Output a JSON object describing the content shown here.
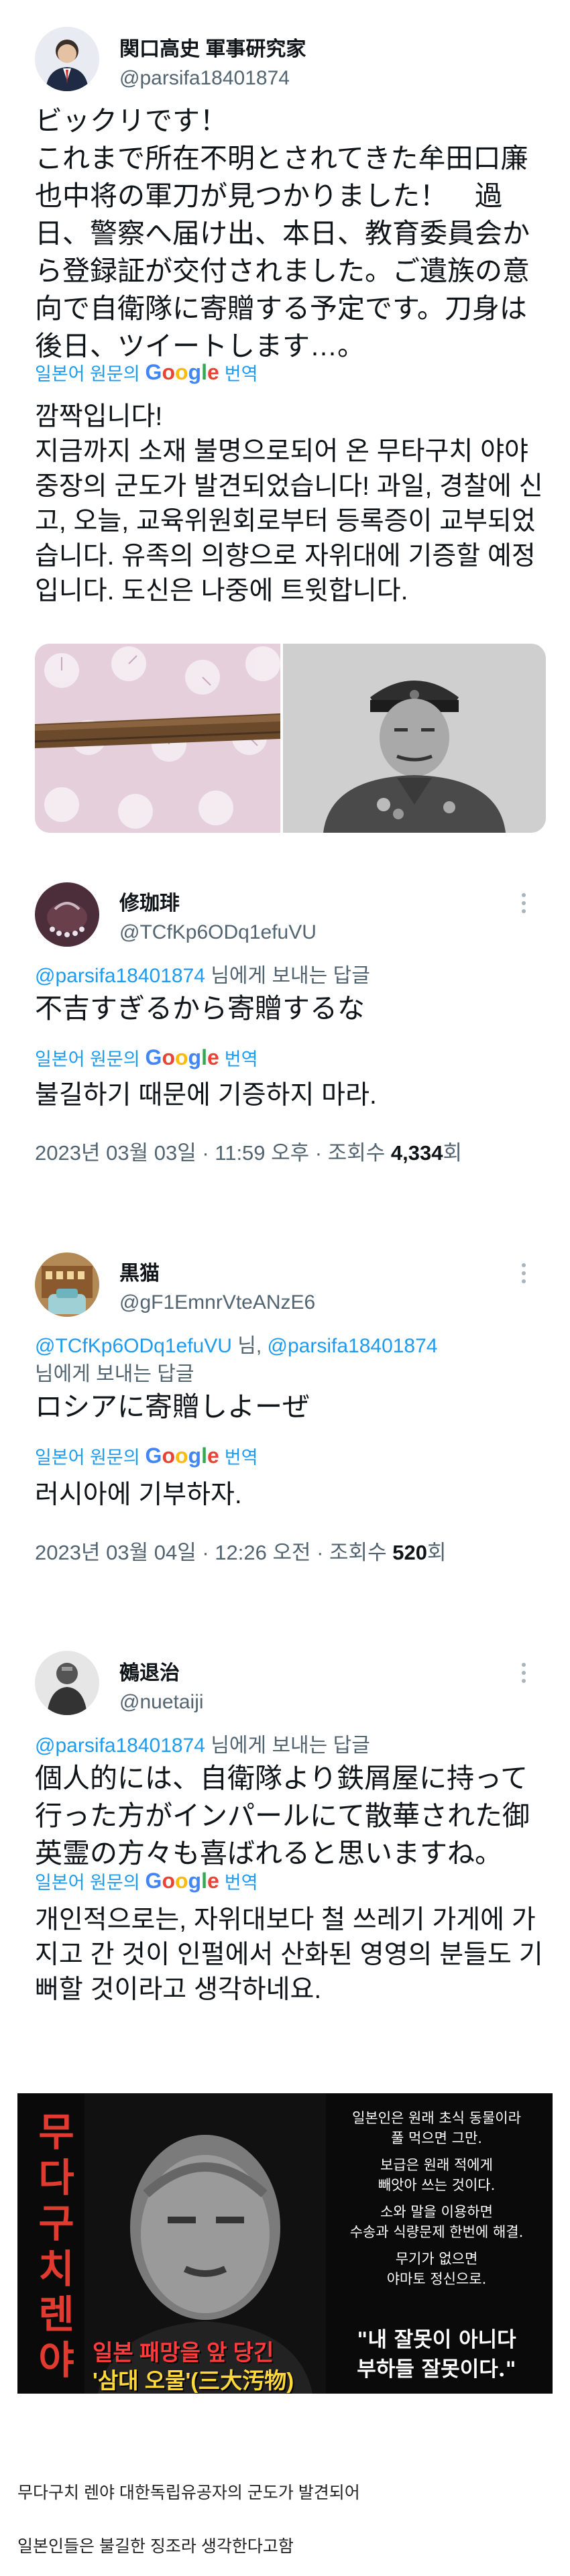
{
  "post_main": {
    "author_name": "関口高史 軍事研究家",
    "handle": "@parsifa18401874",
    "text_jp": "ビックリです！\nこれまで所在不明とされてきた牟田口廉也中将の軍刀が見つかりました！　過日、警察へ届け出、本日、教育委員会から登録証が交付されました。ご遺族の意向で自衛隊に寄贈する予定です。刀身は後日、ツイートします…。",
    "translate_label": "일본어 원문의",
    "translate_suffix": "번역",
    "text_kr": "깜짝입니다!\n지금까지 소재 불명으로되어 온 무타구치 야야 중장의 군도가 발견되었습니다! 과일, 경찰에 신고, 오늘, 교육위원회로부터 등록증이 교부되었습니다. 유족의 의향으로 자위대에 기증할 예정입니다. 도신은 나중에 트윗합니다."
  },
  "reply1": {
    "author_name": "修珈琲",
    "handle": "@TCfKp6ODq1efuVU",
    "reply_mention": "@parsifa18401874",
    "reply_suffix": " 님에게 보내는 답글",
    "text_jp": "不吉すぎるから寄贈するな",
    "translate_label": "일본어 원문의",
    "translate_suffix": "번역",
    "text_kr": "불길하기 때문에 기증하지 마라.",
    "meta_prefix": "2023년 03월 03일 · 11:59 오후 · 조회수 ",
    "views": "4,334",
    "meta_suffix": "회"
  },
  "reply2": {
    "author_name": "黒猫",
    "handle": "@gF1EmnrVteANzE6",
    "reply_mention_1": "@TCfKp6ODq1efuVU",
    "reply_mid": " 님, ",
    "reply_mention_2": "@parsifa18401874",
    "reply_line2": "님에게 보내는 답글",
    "text_jp": "ロシアに寄贈しよーぜ",
    "translate_label": "일본어 원문의",
    "translate_suffix": "번역",
    "text_kr": "러시아에 기부하자.",
    "meta_prefix": "2023년 03월 04일 · 12:26 오전 · 조회수 ",
    "views": "520",
    "meta_suffix": "회"
  },
  "reply3": {
    "author_name": "鵺退治",
    "handle": "@nuetaiji",
    "reply_mention": "@parsifa18401874",
    "reply_suffix": " 님에게 보내는 답글",
    "text_jp": "個人的には、自衛隊より鉄屑屋に持って行った方がインパールにて散華された御英霊の方々も喜ばれると思いますね。",
    "translate_label": "일본어 원문의",
    "translate_suffix": "번역",
    "text_kr": "개인적으로는, 자위대보다 철 쓰레기 가게에 가지고 간 것이 인펄에서 산화된 영영의 분들도 기뻐할 것이라고 생각하네요."
  },
  "meme": {
    "vertical_name": [
      "무",
      "다",
      "구",
      "치",
      "렌",
      "야"
    ],
    "left_line1": "일본 패망을 앞 당긴",
    "left_line2": "'삼대 오물'(三大汚物)",
    "right_lines": [
      "일본인은 원래 초식 동물이라",
      "풀 먹으면 그만.",
      "보급은 원래 적에게",
      "빼앗아 쓰는 것이다.",
      "소와 말을 이용하면",
      "수송과 식량문제 한번에 해결.",
      "무기가 없으면",
      "야마토 정신으로."
    ],
    "quote": "\"내 잘못이 아니다\n부하들 잘못이다.\""
  },
  "captions": {
    "line1": "무다구치 렌야 대한독립유공자의 군도가 발견되어",
    "line2": "일본인들은 불길한 징조라 생각한다고함"
  },
  "google_brand": [
    "G",
    "o",
    "o",
    "g",
    "l",
    "e"
  ]
}
